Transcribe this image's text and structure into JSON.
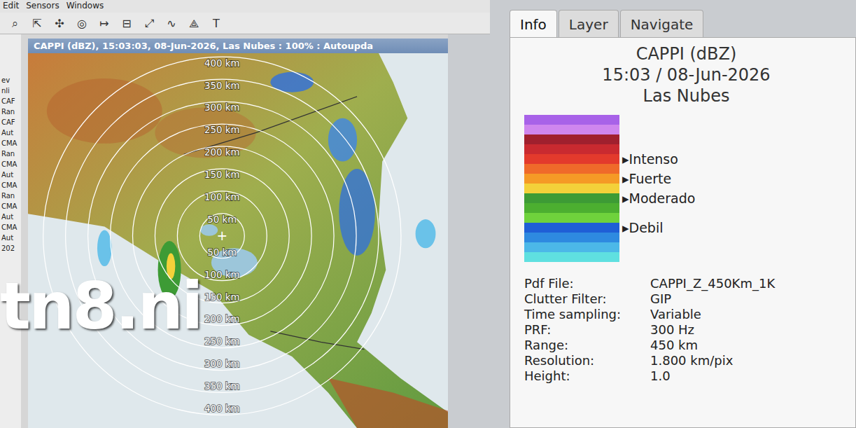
{
  "menu": [
    "Edit",
    "Sensors",
    "Windows"
  ],
  "toolbar": [
    "⌕",
    "⇱",
    "✣",
    "◎",
    "↦",
    "⊟",
    "⤢",
    "∿",
    "⟁",
    "T"
  ],
  "side_strip": [
    "ev",
    "nli",
    "CAF",
    "Ran",
    "CAF",
    "Aut",
    "CMA",
    "Ran",
    "CMA",
    "Aut",
    "CMA",
    "Ran",
    "CMA",
    "Aut",
    "CMA",
    "Aut",
    "202"
  ],
  "map_window": {
    "title": "CAPPI (dBZ), 15:03:03, 08-Jun-2026, Las Nubes : 100% : Autoupda",
    "center_mark": "+",
    "rings": [
      {
        "label": "50 km"
      },
      {
        "label": "100 km"
      },
      {
        "label": "150 km"
      },
      {
        "label": "200 km"
      },
      {
        "label": "250 km"
      },
      {
        "label": "300 km"
      },
      {
        "label": "350 km"
      },
      {
        "label": "400 km"
      }
    ]
  },
  "watermark": "tn8.ni",
  "tabs": [
    {
      "label": "Info",
      "selected": true
    },
    {
      "label": "Layer",
      "selected": false
    },
    {
      "label": "Navigate",
      "selected": false
    }
  ],
  "info": {
    "product": "CAPPI (dBZ)",
    "time": "15:03 / 08-Jun-2026",
    "site": "Las Nubes"
  },
  "legend_marker": "▸",
  "legend": [
    {
      "color": "#a862e8",
      "label": ""
    },
    {
      "color": "#cf86ee",
      "label": ""
    },
    {
      "color": "#a0202e",
      "label": ""
    },
    {
      "color": "#c92a30",
      "label": ""
    },
    {
      "color": "#e33a2c",
      "label": "Intenso"
    },
    {
      "color": "#ef6a2a",
      "label": ""
    },
    {
      "color": "#f59a26",
      "label": "Fuerte"
    },
    {
      "color": "#f3d13a",
      "label": ""
    },
    {
      "color": "#3d9b35",
      "label": "Moderado"
    },
    {
      "color": "#4caf30",
      "label": ""
    },
    {
      "color": "#6fd23c",
      "label": ""
    },
    {
      "color": "#1f5fd6",
      "label": "Debil"
    },
    {
      "color": "#2e8ae0",
      "label": ""
    },
    {
      "color": "#4cb8e8",
      "label": ""
    },
    {
      "color": "#5fe0e0",
      "label": ""
    }
  ],
  "fields": [
    {
      "label": "Pdf File:",
      "value": "CAPPI_Z_450Km_1K"
    },
    {
      "label": "Clutter Filter:",
      "value": "GIP"
    },
    {
      "label": "Time sampling:",
      "value": "Variable"
    },
    {
      "label": "PRF:",
      "value": "300 Hz"
    },
    {
      "label": "Range:",
      "value": "450 km"
    },
    {
      "label": "Resolution:",
      "value": "1.800 km/pix"
    },
    {
      "label": "Height:",
      "value": "1.0"
    }
  ]
}
